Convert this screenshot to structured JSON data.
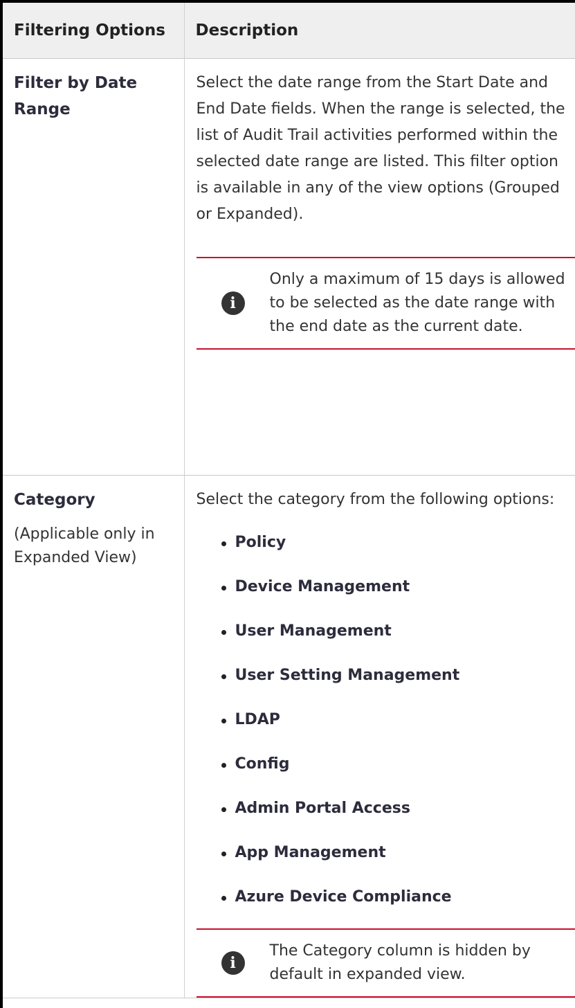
{
  "table": {
    "headers": [
      "Filtering Options",
      "Description"
    ],
    "rows": [
      {
        "name": "Filter by Date Range",
        "subtext": "",
        "description": "Select the date range from the Start Date and End Date fields. When the range is selected, the list of Audit Trail activities performed within the selected date range are listed. This filter option is available in any of the view options (Grouped or Expanded).",
        "note": "Only a maximum of 15 days is allowed to be selected as the date range with the end date as the current date."
      },
      {
        "name": "Category",
        "subtext": "(Applicable only in Expanded  View)",
        "description": "Select the category from the following options:",
        "options": [
          "Policy",
          "Device Management",
          "User Management",
          "User Setting Management",
          "LDAP",
          "Config",
          "Admin Portal Access",
          "App Management",
          "Azure Device Compliance"
        ],
        "note": "The Category column is hidden by default in expanded view."
      }
    ]
  },
  "icons": {
    "note_icon": "info-icon",
    "note_icon_glyph": "i"
  },
  "colors": {
    "note_border": "#c8102e",
    "header_bg": "#efefef"
  }
}
